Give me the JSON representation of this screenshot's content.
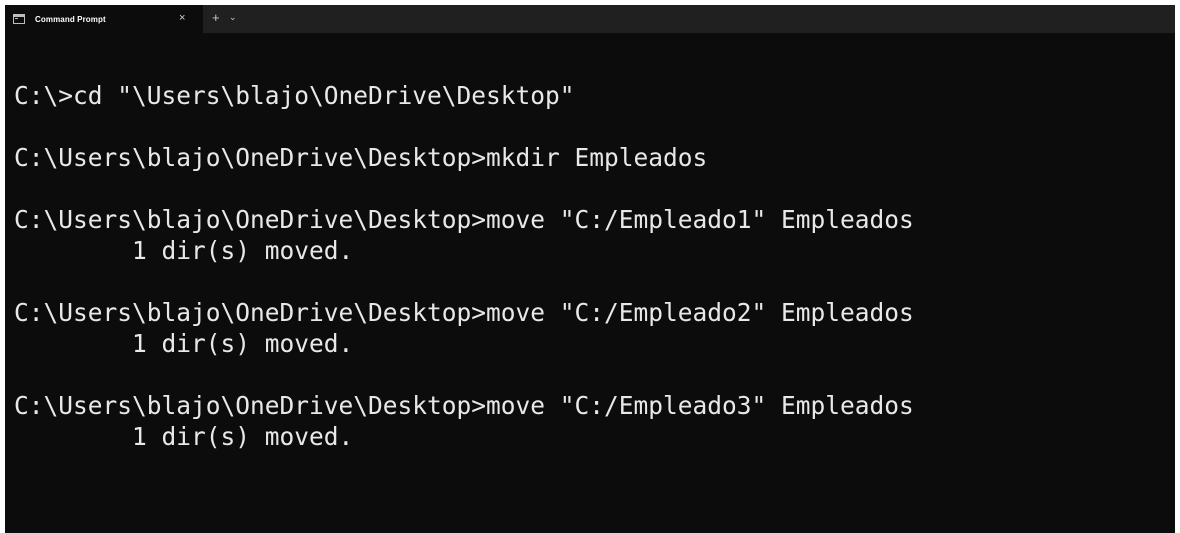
{
  "tab": {
    "title": "Command Prompt",
    "close_glyph": "×",
    "new_tab_glyph": "+",
    "dropdown_glyph": "⌄",
    "icon": "terminal-icon"
  },
  "terminal": {
    "lines": [
      "",
      "C:\\>cd \"\\Users\\blajo\\OneDrive\\Desktop\"",
      "",
      "C:\\Users\\blajo\\OneDrive\\Desktop>mkdir Empleados",
      "",
      "C:\\Users\\blajo\\OneDrive\\Desktop>move \"C:/Empleado1\" Empleados",
      "        1 dir(s) moved.",
      "",
      "C:\\Users\\blajo\\OneDrive\\Desktop>move \"C:/Empleado2\" Empleados",
      "        1 dir(s) moved.",
      "",
      "C:\\Users\\blajo\\OneDrive\\Desktop>move \"C:/Empleado3\" Empleados",
      "        1 dir(s) moved.",
      ""
    ]
  },
  "colors": {
    "background": "#0c0c0c",
    "tabbar": "#202020",
    "text": "#e8e8e8"
  }
}
